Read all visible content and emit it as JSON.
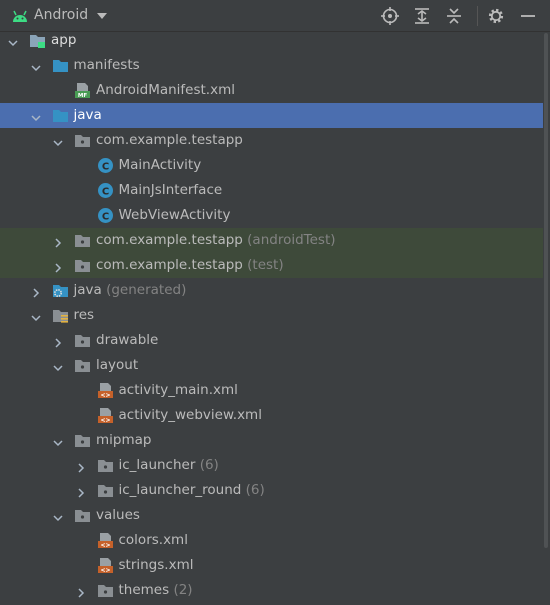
{
  "toolbar": {
    "title": "Android",
    "icons": [
      "android-icon",
      "dropdown-icon",
      "locate-icon",
      "expand-all-icon",
      "collapse-all-icon",
      "gear-icon",
      "minimize-icon"
    ]
  },
  "tree": [
    {
      "label": "app",
      "suffix": "",
      "depth": 0,
      "expanded": true,
      "icon": "module",
      "name": "tree-item-app"
    },
    {
      "label": "manifests",
      "suffix": "",
      "depth": 1,
      "expanded": true,
      "icon": "folder-blue",
      "name": "tree-item-manifests"
    },
    {
      "label": "AndroidManifest.xml",
      "suffix": "",
      "depth": 2,
      "expanded": null,
      "icon": "manifest",
      "name": "tree-item-androidmanifest"
    },
    {
      "label": "java",
      "suffix": "",
      "depth": 1,
      "expanded": true,
      "icon": "folder-blue",
      "name": "tree-item-java",
      "selected": true
    },
    {
      "label": "com.example.testapp",
      "suffix": "",
      "depth": 2,
      "expanded": true,
      "icon": "package",
      "name": "tree-item-package-main"
    },
    {
      "label": "MainActivity",
      "suffix": "",
      "depth": 3,
      "expanded": null,
      "icon": "class",
      "name": "tree-item-mainactivity"
    },
    {
      "label": "MainJsInterface",
      "suffix": "",
      "depth": 3,
      "expanded": null,
      "icon": "class",
      "name": "tree-item-mainjsinterface"
    },
    {
      "label": "WebViewActivity",
      "suffix": "",
      "depth": 3,
      "expanded": null,
      "icon": "class",
      "name": "tree-item-webviewactivity"
    },
    {
      "label": "com.example.testapp",
      "suffix": "(androidTest)",
      "depth": 2,
      "expanded": false,
      "icon": "package",
      "name": "tree-item-package-androidtest",
      "band": true
    },
    {
      "label": "com.example.testapp",
      "suffix": "(test)",
      "depth": 2,
      "expanded": false,
      "icon": "package",
      "name": "tree-item-package-test",
      "band": true
    },
    {
      "label": "java",
      "suffix": "(generated)",
      "depth": 1,
      "expanded": false,
      "icon": "folder-generated",
      "name": "tree-item-java-generated"
    },
    {
      "label": "res",
      "suffix": "",
      "depth": 1,
      "expanded": true,
      "icon": "folder-res",
      "name": "tree-item-res"
    },
    {
      "label": "drawable",
      "suffix": "",
      "depth": 2,
      "expanded": false,
      "icon": "package",
      "name": "tree-item-drawable"
    },
    {
      "label": "layout",
      "suffix": "",
      "depth": 2,
      "expanded": true,
      "icon": "package",
      "name": "tree-item-layout"
    },
    {
      "label": "activity_main.xml",
      "suffix": "",
      "depth": 3,
      "expanded": null,
      "icon": "xml",
      "name": "tree-item-activity-main-xml"
    },
    {
      "label": "activity_webview.xml",
      "suffix": "",
      "depth": 3,
      "expanded": null,
      "icon": "xml",
      "name": "tree-item-activity-webview-xml"
    },
    {
      "label": "mipmap",
      "suffix": "",
      "depth": 2,
      "expanded": true,
      "icon": "package",
      "name": "tree-item-mipmap"
    },
    {
      "label": "ic_launcher",
      "suffix": "(6)",
      "depth": 3,
      "expanded": false,
      "icon": "package",
      "name": "tree-item-ic-launcher"
    },
    {
      "label": "ic_launcher_round",
      "suffix": "(6)",
      "depth": 3,
      "expanded": false,
      "icon": "package",
      "name": "tree-item-ic-launcher-round"
    },
    {
      "label": "values",
      "suffix": "",
      "depth": 2,
      "expanded": true,
      "icon": "package",
      "name": "tree-item-values"
    },
    {
      "label": "colors.xml",
      "suffix": "",
      "depth": 3,
      "expanded": null,
      "icon": "xml",
      "name": "tree-item-colors-xml"
    },
    {
      "label": "strings.xml",
      "suffix": "",
      "depth": 3,
      "expanded": null,
      "icon": "xml",
      "name": "tree-item-strings-xml"
    },
    {
      "label": "themes",
      "suffix": "(2)",
      "depth": 3,
      "expanded": false,
      "icon": "package",
      "name": "tree-item-themes"
    }
  ],
  "colors": {
    "background": "#3c3f41",
    "selection": "#4b6eaf",
    "test_band": "#3e4a3a",
    "folder_blue": "#3592c4",
    "class_teal": "#3592c4",
    "xml_orange": "#c5612a",
    "manifest_green": "#499c54",
    "android_green": "#3ddc84"
  }
}
